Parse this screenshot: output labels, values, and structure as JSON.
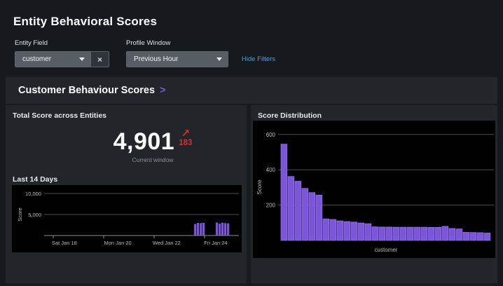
{
  "page_title": "Entity Behavioral Scores",
  "icons": {
    "clear": "×",
    "trend_up_arrow": "↗",
    "drilldown_chevron": ">"
  },
  "colors": {
    "bar_purple": "#7B56DB",
    "bar_purple_edge": "#9577E8",
    "alert_red": "#D0342C",
    "link_blue": "#4F9FD6"
  },
  "filters": {
    "entity_field": {
      "label": "Entity Field",
      "value": "customer"
    },
    "profile_window": {
      "label": "Profile Window",
      "value": "Previous Hour"
    },
    "hide_filters_label": "Hide Filters"
  },
  "section": {
    "title": "Customer Behaviour Scores"
  },
  "kpi_panel": {
    "title": "Total Score across Entities",
    "value": "4,901",
    "delta": "183",
    "delta_direction": "up",
    "caption": "Current window",
    "sparkline_title": "Last 14 Days"
  },
  "distribution_panel": {
    "title": "Score Distribution"
  },
  "chart_data": [
    {
      "id": "last-14-days",
      "type": "bar",
      "title": "Last 14 Days",
      "xlabel": "",
      "ylabel": "Score",
      "ylim": [
        0,
        12000
      ],
      "yticks": [
        5000,
        10000
      ],
      "ytick_labels": [
        "5,000",
        "10,000"
      ],
      "grid": true,
      "xticks": [
        {
          "label": "Sat Jan 18",
          "tick_frac": 0.047,
          "label_frac": 0.104
        },
        {
          "label": "Mon Jan 20",
          "tick_frac": 0.306,
          "label_frac": 0.378
        },
        {
          "label": "Wed Jan 22",
          "tick_frac": 0.565,
          "label_frac": 0.629
        },
        {
          "label": "Fri Jan 24",
          "tick_frac": 0.824,
          "label_frac": 0.881
        }
      ],
      "bars": [
        {
          "frac": 0.77,
          "value": 2750
        },
        {
          "frac": 0.784,
          "value": 3000
        },
        {
          "frac": 0.799,
          "value": 2950
        },
        {
          "frac": 0.813,
          "value": 3000
        },
        {
          "frac": 0.881,
          "value": 3100
        },
        {
          "frac": 0.896,
          "value": 2850
        },
        {
          "frac": 0.91,
          "value": 3050
        },
        {
          "frac": 0.924,
          "value": 2950
        },
        {
          "frac": 0.939,
          "value": 2900
        }
      ]
    },
    {
      "id": "score-distribution",
      "type": "bar",
      "title": "Score Distribution",
      "xlabel": "customer",
      "ylabel": "Score",
      "ylim": [
        0,
        620
      ],
      "yticks": [
        200,
        400,
        600
      ],
      "ytick_labels": [
        "200",
        "400",
        "600"
      ],
      "grid": true,
      "values": [
        545,
        362,
        335,
        295,
        271,
        257,
        122,
        119,
        111,
        107,
        104,
        99,
        95,
        77,
        76,
        76,
        75,
        75,
        75,
        75,
        75,
        74,
        74,
        80,
        68,
        65,
        46,
        45,
        44,
        42
      ]
    }
  ]
}
